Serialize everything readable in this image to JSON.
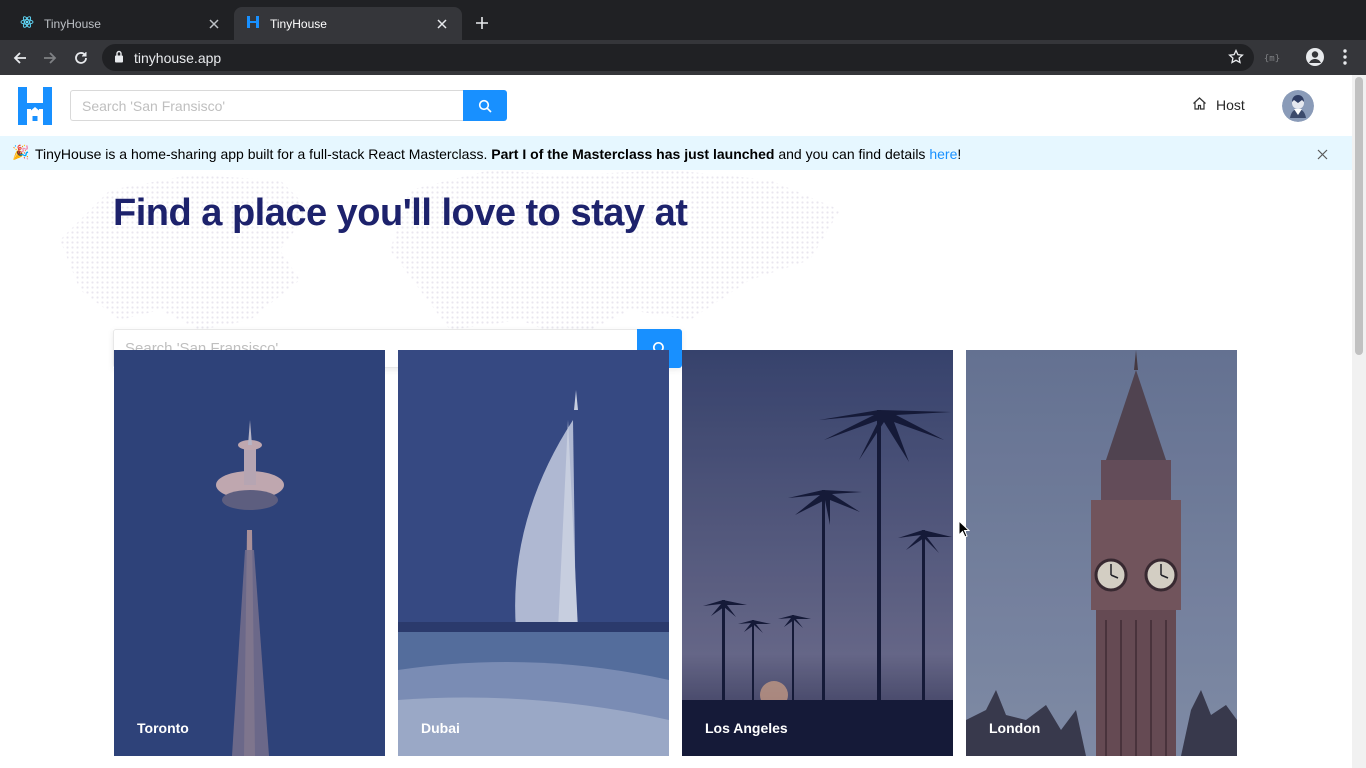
{
  "browser": {
    "tabs": [
      {
        "title": "TinyHouse",
        "icon": "react-icon"
      },
      {
        "title": "TinyHouse",
        "icon": "tinyhouse-icon"
      }
    ],
    "url": "tinyhouse.app"
  },
  "header": {
    "search_placeholder": "Search 'San Fransisco'",
    "host_label": "Host"
  },
  "banner": {
    "emoji": "🎉",
    "text_start": "TinyHouse is a home-sharing app built for a full-stack React Masterclass. ",
    "text_bold": "Part I of the Masterclass has just launched",
    "text_mid": " and you can find details ",
    "link_text": "here",
    "text_end": "!"
  },
  "hero": {
    "title": "Find a place you'll love to stay at",
    "search_placeholder": "Search 'San Fransisco'"
  },
  "cards": [
    {
      "city": "Toronto"
    },
    {
      "city": "Dubai"
    },
    {
      "city": "Los Angeles"
    },
    {
      "city": "London"
    }
  ],
  "colors": {
    "accent": "#1890ff",
    "title": "#1d226c",
    "banner_bg": "#e6f7ff"
  }
}
